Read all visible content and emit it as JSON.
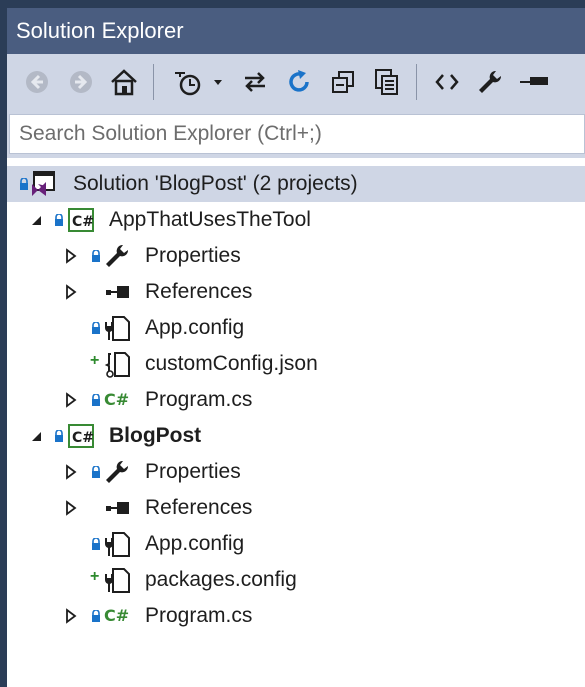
{
  "window": {
    "title": "Solution Explorer"
  },
  "toolbar": {
    "icons": [
      "back-arrow-icon",
      "forward-arrow-icon",
      "home-icon",
      "pending-changes-filter-icon",
      "sync-with-active-document-icon",
      "refresh-icon",
      "collapse-all-icon",
      "show-all-files-icon",
      "view-code-icon",
      "properties-icon",
      "preview-selected-items-icon"
    ]
  },
  "search": {
    "placeholder": "Search Solution Explorer (Ctrl+;)"
  },
  "tree": {
    "solution": {
      "label": "Solution 'BlogPost' (2 projects)"
    },
    "project1": {
      "label": "AppThatUsesTheTool",
      "items": [
        {
          "label": "Properties"
        },
        {
          "label": "References"
        },
        {
          "label": "App.config"
        },
        {
          "label": "customConfig.json"
        },
        {
          "label": "Program.cs"
        }
      ]
    },
    "project2": {
      "label": "BlogPost",
      "items": [
        {
          "label": "Properties"
        },
        {
          "label": "References"
        },
        {
          "label": "App.config"
        },
        {
          "label": "packages.config"
        },
        {
          "label": "Program.cs"
        }
      ]
    }
  },
  "colors": {
    "titlebar": "#4a5d80",
    "toolbar": "#cfd6e5",
    "accent_blue": "#1a73c9",
    "csharp_green": "#388a34"
  }
}
